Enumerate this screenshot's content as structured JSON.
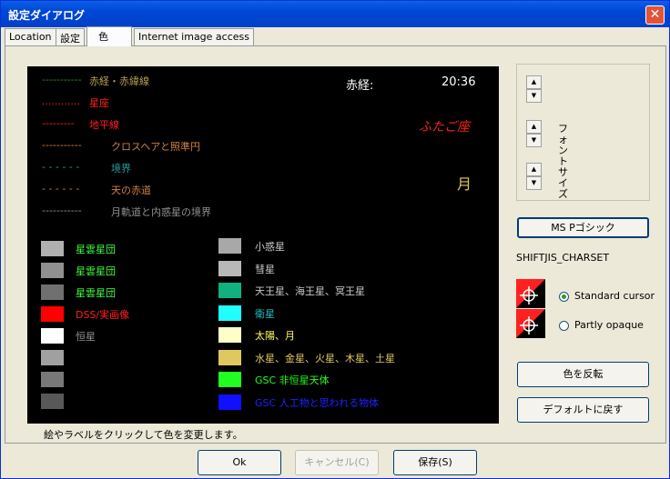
{
  "window": {
    "title": "設定ダイアログ",
    "close_glyph": "✕"
  },
  "tabs": [
    "Location",
    "設定",
    "色",
    "Internet image access"
  ],
  "sky": {
    "lines": [
      {
        "dash": "-----------",
        "label": "赤経・赤緯線",
        "color": "#1c9a1c",
        "label_color": "#b4a050"
      },
      {
        "dash": "............",
        "label": "星座",
        "color": "#ff2020",
        "label_color": "#ff2020"
      },
      {
        "dash": "---------",
        "label": "地平線",
        "color": "#ff2020",
        "label_color": "#ff2020"
      },
      {
        "dash": "-----------",
        "label": "クロスヘアと照準円",
        "color": "#d08040",
        "label_color": "#d08040"
      },
      {
        "dash": "- - - - - -",
        "label": "境界",
        "color": "#2a9a9a",
        "label_color": "#2a9a9a"
      },
      {
        "dash": "- - - - - -",
        "label": "天の赤道",
        "color": "#d08040",
        "label_color": "#d08040"
      },
      {
        "dash": "-----------",
        "label": "月軌道と内惑星の境界",
        "color": "#909090",
        "label_color": "#909090"
      }
    ],
    "ra_label": "赤経:",
    "time": "20:36",
    "constellation": "ふたご座",
    "moon": "月",
    "left_swatches": [
      {
        "color": "#b0b0b0",
        "label": "星雲星団",
        "label_color": "#40ff40"
      },
      {
        "color": "#909090",
        "label": "星雲星団",
        "label_color": "#40ff40"
      },
      {
        "color": "#707070",
        "label": "星雲星団",
        "label_color": "#40ff40"
      },
      {
        "color": "#ff0000",
        "label": "DSS/実画像",
        "label_color": "#ff2020"
      },
      {
        "color": "#ffffff",
        "label": "恒星",
        "label_color": "#909090"
      },
      {
        "color": "#a0a0a0",
        "label": "",
        "label_color": "#909090"
      },
      {
        "color": "#787878",
        "label": "",
        "label_color": "#909090"
      },
      {
        "color": "#585858",
        "label": "",
        "label_color": "#909090"
      }
    ],
    "right_swatches": [
      {
        "color": "#a8a8a8",
        "label": "小惑星",
        "label_color": "#c8c8c8"
      },
      {
        "color": "#b8b8b8",
        "label": "彗星",
        "label_color": "#c8c8c8"
      },
      {
        "color": "#10b080",
        "label": "天王星、海王星、冥王星",
        "label_color": "#c8c8c8"
      },
      {
        "color": "#20ffff",
        "label": "衛星",
        "label_color": "#20c0c0"
      },
      {
        "color": "#ffffc8",
        "label": "太陽、月",
        "label_color": "#ffff60"
      },
      {
        "color": "#e0c860",
        "label": "水星、金星、火星、木星、土星",
        "label_color": "#e0c860"
      },
      {
        "color": "#20ff20",
        "label": "GSC 非恒星天体",
        "label_color": "#20ff20"
      },
      {
        "color": "#1010ff",
        "label": "GSC 人工物と思われる物体",
        "label_color": "#2020ff"
      }
    ]
  },
  "status": "絵やラベルをクリックして色を変更します。",
  "font_size_label": "フォントサイズ",
  "font_button": "MS Pゴシック",
  "charset": "SHIFTJIS_CHARSET",
  "radios": [
    {
      "label": "Standard cursor",
      "checked": true
    },
    {
      "label": "Partly opaque",
      "checked": false
    }
  ],
  "buttons": {
    "invert": "色を反転",
    "default": "デフォルトに戻す",
    "ok": "Ok",
    "cancel": "キャンセル(C)",
    "save": "保存(S)"
  }
}
